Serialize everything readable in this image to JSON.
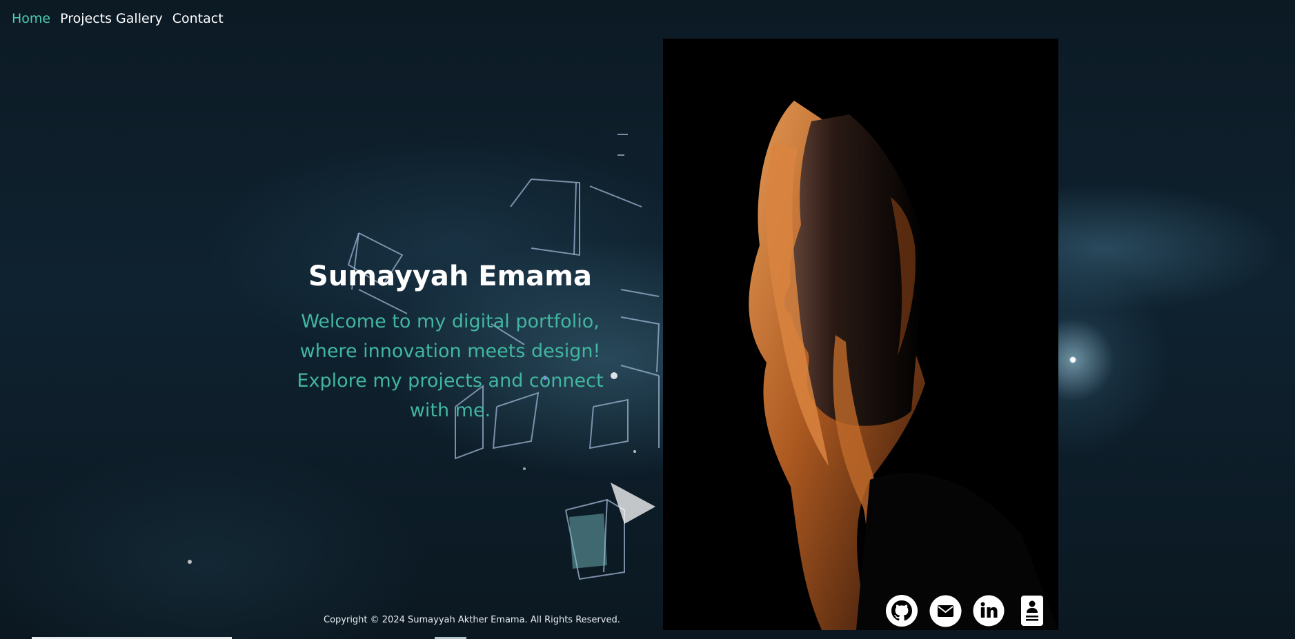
{
  "nav": {
    "items": [
      {
        "label": "Home",
        "active": true
      },
      {
        "label": "Projects Gallery",
        "active": false
      },
      {
        "label": "Contact",
        "active": false
      }
    ]
  },
  "hero": {
    "name": "Sumayyah Emama",
    "tagline": "Welcome to my digital portfolio, where innovation meets design! Explore my projects and connect with me."
  },
  "socials": [
    {
      "icon": "github-icon"
    },
    {
      "icon": "mail-icon"
    },
    {
      "icon": "linkedin-icon"
    },
    {
      "icon": "resume-icon"
    }
  ],
  "footer": {
    "copyright": "Copyright © 2024 Sumayyah Akther Emama. All Rights Reserved."
  },
  "colors": {
    "accent": "#4ecdb4",
    "tagline": "#41b6a0"
  }
}
